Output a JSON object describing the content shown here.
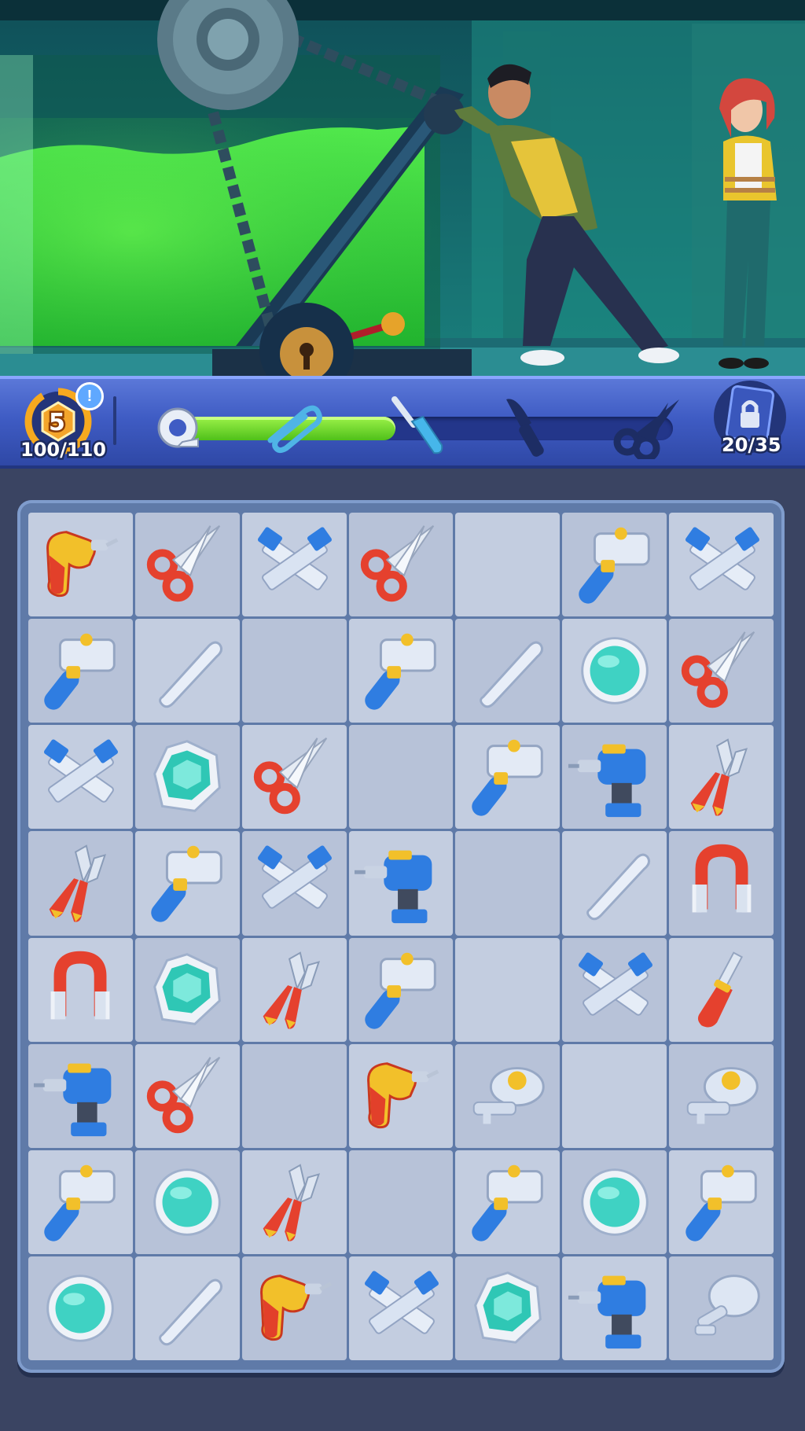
{
  "hud": {
    "level": "5",
    "xp": "100/110",
    "alert": "!",
    "moves": "20/35",
    "progress": 0.43,
    "tool_icons": [
      "tape-icon",
      "paperclip-icon",
      "screwdriver-icon",
      "knife-icon",
      "scissors-icon"
    ]
  },
  "board": {
    "rows": [
      [
        "drill",
        "scissors",
        "crossed-wrenches",
        "scissors",
        "",
        "hammer",
        "crossed-wrenches"
      ],
      [
        "hammer",
        "flat-wrench",
        "",
        "hammer",
        "flat-wrench",
        "gem-round",
        "scissors"
      ],
      [
        "crossed-wrenches",
        "gem-hex",
        "scissors",
        "",
        "hammer",
        "power-drill",
        "pliers"
      ],
      [
        "pliers",
        "hammer",
        "crossed-wrenches",
        "power-drill",
        "",
        "flat-wrench",
        "magnet"
      ],
      [
        "magnet",
        "gem-hex",
        "pliers",
        "hammer",
        "",
        "crossed-wrenches",
        "screwdriver"
      ],
      [
        "power-drill",
        "scissors",
        "",
        "drill",
        "key",
        "",
        "key"
      ],
      [
        "hammer",
        "gem-round",
        "pliers",
        "",
        "hammer",
        "gem-round",
        "hammer"
      ],
      [
        "gem-round",
        "flat-wrench",
        "drill",
        "crossed-wrenches",
        "gem-hex",
        "power-drill",
        "mirror-key"
      ]
    ]
  },
  "colors": {
    "hud": "#3f5cc4",
    "progress": "#5ed11d",
    "slime": "#39e83a",
    "tile": "#c3cde0",
    "tile_dark": "#b7c2d8"
  }
}
